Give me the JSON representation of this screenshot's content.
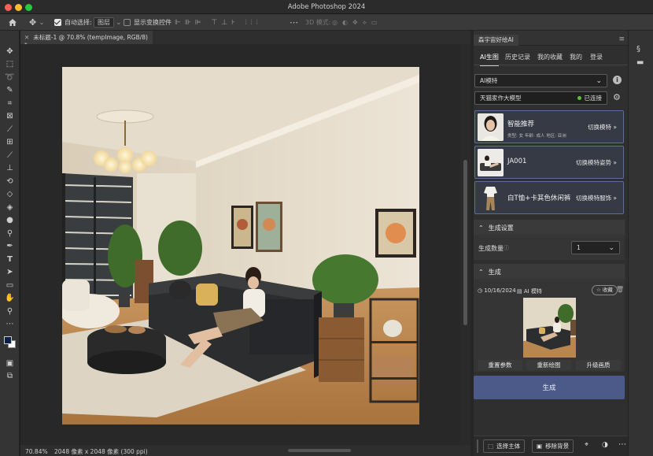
{
  "window": {
    "title": "Adobe Photoshop 2024"
  },
  "options_bar": {
    "auto_select_label": "自动选择:",
    "auto_select_value": "图层",
    "transform_controls_label": "显示变换控件",
    "mode_3d_label": "3D 模式:"
  },
  "document": {
    "tab_title": "未标题-1 @ 70.8% (tempImage, RGB/8) *",
    "zoom": "70.84%",
    "info": "2048 像素 x 2048 像素 (300 ppi)"
  },
  "panel": {
    "title": "森宇宙好绘AI",
    "tabs": [
      {
        "label": "AI生图",
        "active": true
      },
      {
        "label": "历史记录"
      },
      {
        "label": "我的收藏"
      },
      {
        "label": "我的"
      },
      {
        "label": "登录"
      }
    ],
    "model_select": "AI模特",
    "engine_label": "天猫家作大模型",
    "connection_status": "已连接",
    "cards": [
      {
        "title": "智能推荐",
        "subtitle": "类型: 女  年龄: 成人  地区: 亚洲",
        "action": "切换模特"
      },
      {
        "title": "JA001",
        "action": "切换模特姿势"
      },
      {
        "title": "白T恤+卡其色休闲裤",
        "action": "切换模特服饰"
      }
    ],
    "settings_section": "生成设置",
    "quantity_label": "生成数量",
    "quantity_value": "1",
    "generate_section": "生成",
    "result": {
      "date": "10/16/2024",
      "type": "AI 模特",
      "favorite_label": "收藏"
    },
    "result_buttons": [
      "重置参数",
      "重新绘图",
      "升级画质"
    ],
    "generate_button": "生成",
    "bottom_buttons": [
      "选择主体",
      "移除背景"
    ]
  },
  "colors": {
    "accent": "#4c5a8a",
    "card_border": "#5c6f96",
    "status_green": "#5bc236",
    "close": "#ff5f57",
    "minimize": "#febc2e",
    "maximize": "#28c840"
  }
}
